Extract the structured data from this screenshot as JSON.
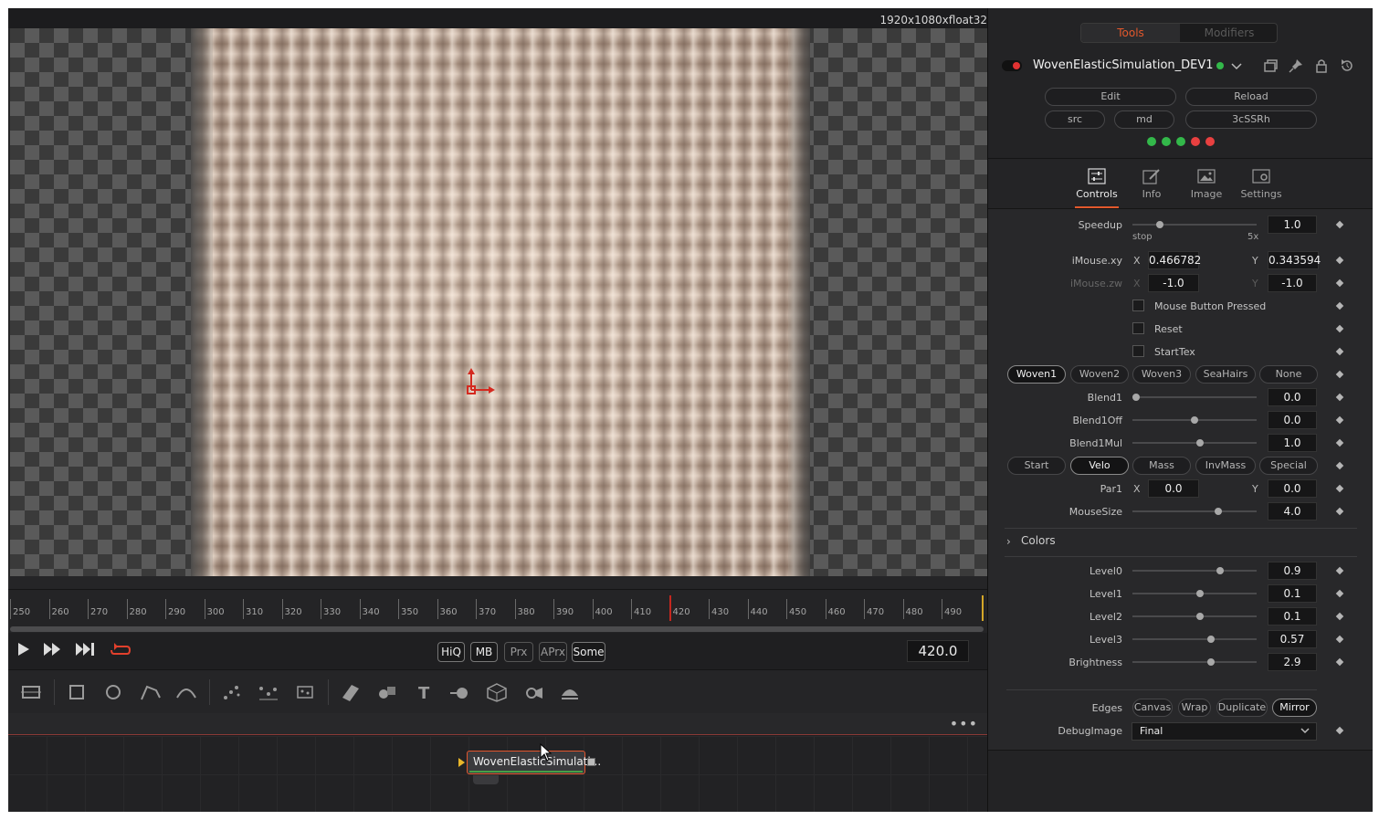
{
  "viewer": {
    "resolution": "1920x1080xfloat32"
  },
  "timeline": {
    "ticks": [
      "250",
      "260",
      "270",
      "280",
      "290",
      "300",
      "310",
      "320",
      "330",
      "340",
      "350",
      "360",
      "370",
      "380",
      "390",
      "400",
      "410",
      "420",
      "430",
      "440",
      "450",
      "460",
      "470",
      "480",
      "490"
    ],
    "current_frame": "420.0"
  },
  "transport": {
    "chips": [
      {
        "label": "HiQ",
        "on": true
      },
      {
        "label": "MB",
        "on": true
      },
      {
        "label": "Prx",
        "on": false
      },
      {
        "label": "APrx",
        "on": false
      },
      {
        "label": "Some",
        "on": true
      }
    ]
  },
  "node": {
    "label": "WovenElasticSimulati..."
  },
  "inspector": {
    "tabs_top": {
      "tools": "Tools",
      "modifiers": "Modifiers"
    },
    "tool_name": "WovenElasticSimulation_DEV1",
    "buttons": {
      "edit": "Edit",
      "reload": "Reload",
      "src": "src",
      "md": "md",
      "code": "3cSSRh"
    },
    "status_dots": [
      "#33b84a",
      "#33b84a",
      "#33b84a",
      "#e84040",
      "#e84040"
    ],
    "tabs": [
      {
        "label": "Controls",
        "icon": "sliders-icon"
      },
      {
        "label": "Info",
        "icon": "pencil-icon"
      },
      {
        "label": "Image",
        "icon": "image-icon"
      },
      {
        "label": "Settings",
        "icon": "gear-icon"
      }
    ],
    "speedup": {
      "label": "Speedup",
      "value": "1.0",
      "min_label": "stop",
      "max_label": "5x",
      "level": 0.2
    },
    "imouse_xy": {
      "label": "iMouse.xy",
      "x_label": "X",
      "x": "0.466782",
      "y_label": "Y",
      "y": "0.343594"
    },
    "imouse_zw": {
      "label": "iMouse.zw",
      "x_label": "X",
      "x": "-1.0",
      "y_label": "Y",
      "y": "-1.0"
    },
    "checkboxes": [
      "Mouse Button Pressed",
      "Reset",
      "StartTex"
    ],
    "woven_buttons": [
      "Woven1",
      "Woven2",
      "Woven3",
      "SeaHairs",
      "None"
    ],
    "woven_selected": "Woven1",
    "blend1": {
      "label": "Blend1",
      "value": "0.0",
      "level": 0.0
    },
    "blend1off": {
      "label": "Blend1Off",
      "value": "0.0",
      "level": 0.5
    },
    "blend1mul": {
      "label": "Blend1Mul",
      "value": "1.0",
      "level": 0.55
    },
    "par_buttons": [
      "Start",
      "Velo",
      "Mass",
      "InvMass",
      "Special"
    ],
    "par_selected": "Velo",
    "par1": {
      "label": "Par1",
      "x_label": "X",
      "x": "0.0",
      "y_label": "Y",
      "y": "0.0"
    },
    "mousesize": {
      "label": "MouseSize",
      "value": "4.0",
      "level": 0.7
    },
    "colors_header": "Colors",
    "level0": {
      "label": "Level0",
      "value": "0.9",
      "level": 0.72
    },
    "level1": {
      "label": "Level1",
      "value": "0.1",
      "level": 0.55
    },
    "level2": {
      "label": "Level2",
      "value": "0.1",
      "level": 0.55
    },
    "level3": {
      "label": "Level3",
      "value": "0.57",
      "level": 0.64
    },
    "brightness": {
      "label": "Brightness",
      "value": "2.9",
      "level": 0.64
    },
    "edges": {
      "label": "Edges",
      "options": [
        "Canvas",
        "Wrap",
        "Duplicate",
        "Mirror"
      ],
      "selected": "Mirror"
    },
    "debugimage": {
      "label": "DebugImage",
      "value": "Final"
    }
  }
}
